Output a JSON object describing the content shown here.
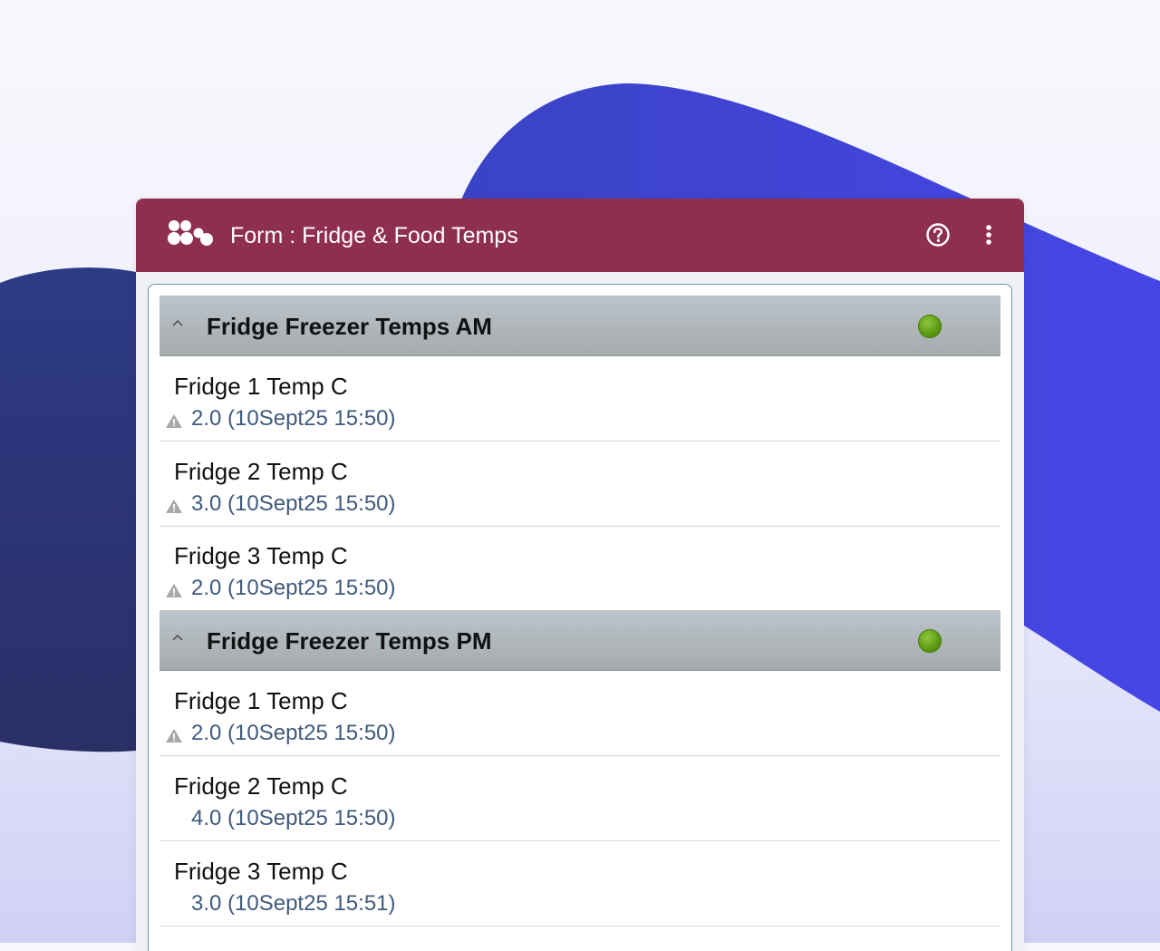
{
  "app_bar": {
    "title": "Form : Fridge & Food Temps",
    "logo_icon": "app-logo-dots-icon",
    "help_icon": "help-circle-icon",
    "menu_icon": "more-vertical-icon",
    "color": "#8f2f4e"
  },
  "sections": [
    {
      "title": "Fridge Freezer Temps AM",
      "status": "complete",
      "status_color": "#5c9a14",
      "items": [
        {
          "label": "Fridge 1 Temp C",
          "value": "2.0 (10Sept25 15:50)",
          "warning": true
        },
        {
          "label": "Fridge 2 Temp C",
          "value": "3.0 (10Sept25 15:50)",
          "warning": true
        },
        {
          "label": "Fridge 3 Temp C",
          "value": "2.0 (10Sept25 15:50)",
          "warning": true
        }
      ]
    },
    {
      "title": "Fridge Freezer Temps PM",
      "status": "complete",
      "status_color": "#5c9a14",
      "items": [
        {
          "label": "Fridge 1 Temp C",
          "value": "2.0 (10Sept25 15:50)",
          "warning": true
        },
        {
          "label": "Fridge 2 Temp C",
          "value": "4.0 (10Sept25 15:50)",
          "warning": false
        },
        {
          "label": "Fridge 3 Temp C",
          "value": "3.0 (10Sept25 15:51)",
          "warning": false
        }
      ]
    }
  ]
}
